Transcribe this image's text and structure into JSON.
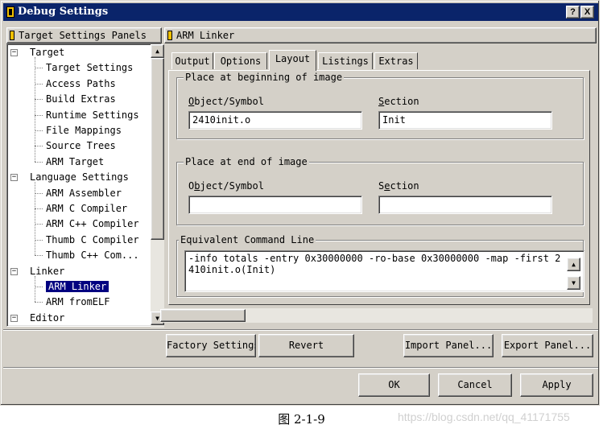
{
  "window": {
    "title": "Debug Settings",
    "help_label": "?",
    "close_label": "X"
  },
  "tree": {
    "header": "Target Settings Panels",
    "items": [
      {
        "label": "Target",
        "level": 0,
        "expander": "−"
      },
      {
        "label": "Target Settings",
        "level": 1
      },
      {
        "label": "Access Paths",
        "level": 1
      },
      {
        "label": "Build Extras",
        "level": 1
      },
      {
        "label": "Runtime Settings",
        "level": 1
      },
      {
        "label": "File Mappings",
        "level": 1
      },
      {
        "label": "Source Trees",
        "level": 1
      },
      {
        "label": "ARM Target",
        "level": 1
      },
      {
        "label": "Language Settings",
        "level": 0,
        "expander": "−"
      },
      {
        "label": "ARM Assembler",
        "level": 1
      },
      {
        "label": "ARM C Compiler",
        "level": 1
      },
      {
        "label": "ARM C++ Compiler",
        "level": 1
      },
      {
        "label": "Thumb C Compiler",
        "level": 1
      },
      {
        "label": "Thumb C++ Com...",
        "level": 1
      },
      {
        "label": "Linker",
        "level": 0,
        "expander": "−"
      },
      {
        "label": "ARM Linker",
        "level": 1,
        "selected": true
      },
      {
        "label": "ARM fromELF",
        "level": 1
      },
      {
        "label": "Editor",
        "level": 0,
        "expander": "−"
      }
    ],
    "scroll_up": "▲",
    "scroll_down": "▼"
  },
  "panel": {
    "header": "ARM Linker",
    "tabs": [
      "Output",
      "Options",
      "Layout",
      "Listings",
      "Extras"
    ],
    "active_tab": "Layout",
    "begin_group": {
      "title": "Place at beginning of image",
      "object_label_pre": "",
      "object_label_ul": "O",
      "object_label_post": "bject/Symbol",
      "object_value": "2410init.o",
      "section_label_pre": "",
      "section_label_ul": "S",
      "section_label_post": "ection",
      "section_value": "Init"
    },
    "end_group": {
      "title": "Place at end of image",
      "object_label_pre": "O",
      "object_label_ul": "b",
      "object_label_post": "ject/Symbol",
      "object_value": "",
      "section_label_pre": "S",
      "section_label_ul": "e",
      "section_label_post": "ction",
      "section_value": ""
    },
    "command_group": {
      "title": "Equivalent Command Line",
      "text": "-info totals -entry 0x30000000 -ro-base 0x30000000 -map -first 2410init.o(Init)"
    }
  },
  "buttons": {
    "factory": "Factory Settings",
    "revert": "Revert",
    "import": "Import Panel...",
    "export": "Export Panel...",
    "ok": "OK",
    "cancel": "Cancel",
    "apply": "Apply"
  },
  "caption": "图 2-1-9",
  "watermark": "https://blog.csdn.net/qq_41171755"
}
